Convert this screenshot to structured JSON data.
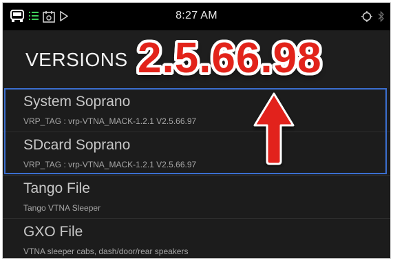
{
  "statusbar": {
    "time": "8:27 AM",
    "icons": [
      "truck-icon",
      "menu-list-icon",
      "calendar-sync-icon",
      "play-icon",
      "location-target-icon",
      "bluetooth-icon"
    ]
  },
  "header": {
    "title": "VERSIONS",
    "callout": "2.5.66.98"
  },
  "list": {
    "items": [
      {
        "name": "System Soprano",
        "detail": "VRP_TAG : vrp-VTNA_MACK-1.2.1 V2.5.66.97"
      },
      {
        "name": "SDcard Soprano",
        "detail": "VRP_TAG : vrp-VTNA_MACK-1.2.1 V2.5.66.97"
      },
      {
        "name": "Tango File",
        "detail": "Tango VTNA Sleeper"
      },
      {
        "name": "GXO File",
        "detail": "VTNA sleeper cabs, dash/door/rear speakers"
      }
    ]
  },
  "colors": {
    "selection_border": "#3b6fd0",
    "callout_red": "#e2231a",
    "background": "#1c1c1c"
  }
}
